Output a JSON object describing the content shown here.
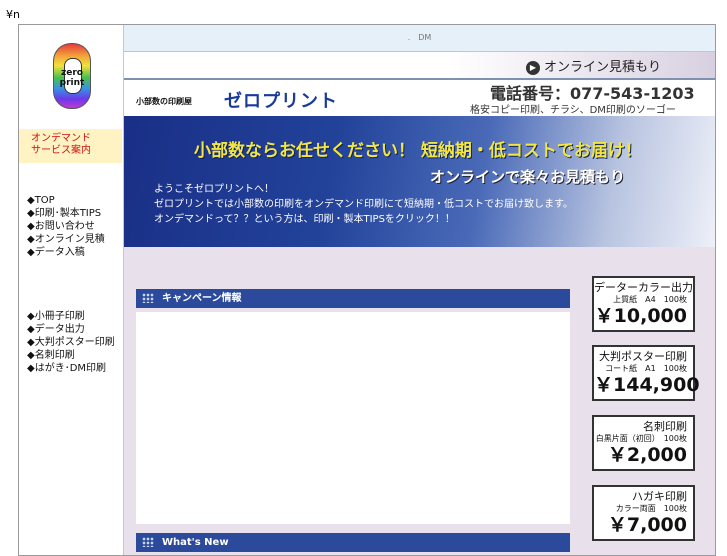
{
  "corner_text": "¥n",
  "topbar": {
    "text": ".　DM"
  },
  "logo": {
    "text_line1": "zero",
    "text_line2": "print"
  },
  "sidebar": {
    "ondemand_line1": "オンデマンド",
    "ondemand_line2": "サービス案内",
    "menu1": [
      "◆TOP",
      "◆印刷･製本TIPS",
      "◆お問い合わせ",
      "◆オンライン見積",
      "◆データ入稿"
    ],
    "menu2": [
      "◆小冊子印刷",
      "◆データ出力",
      "◆大判ポスター印刷",
      "◆名刺印刷",
      "◆はがき･DM印刷"
    ]
  },
  "header": {
    "online_estimate": "オンライン見積もり",
    "small_shop": "小部数の印刷屋",
    "shop_name": "ゼロプリント",
    "phone": "電話番号：077-543-1203",
    "tagline": "格安コピー印刷、チラシ、DM印刷のソーゴー"
  },
  "banner": {
    "headline": "小部数ならお任せください！ 短納期・低コストでお届け！",
    "subheadline": "オンラインで楽々お見積もり",
    "body_line1": "ようこそゼロプリントへ！",
    "body_line2": "ゼロプリントでは小部数の印刷をオンデマンド印刷にて短納期・低コストでお届け致します。",
    "body_line3": "オンデマンドって？？という方は、印刷・製本TIPSをクリック！！"
  },
  "sections": {
    "campaign_title": "キャンペーン情報",
    "whats_new_title": "What's  New"
  },
  "price_cards": [
    {
      "title": "データーカラー出力",
      "spec": "上質紙　A4　100枚",
      "price": "￥10,000"
    },
    {
      "title": "大判ポスター印刷",
      "spec": "コート紙　A1　100枚",
      "price": "￥144,900"
    },
    {
      "title": "名刺印刷",
      "spec": "白黒片面（初回）　100枚",
      "price": "￥2,000"
    },
    {
      "title": "ハガキ印刷",
      "spec": "カラー両面　100枚",
      "price": "￥7,000"
    }
  ]
}
